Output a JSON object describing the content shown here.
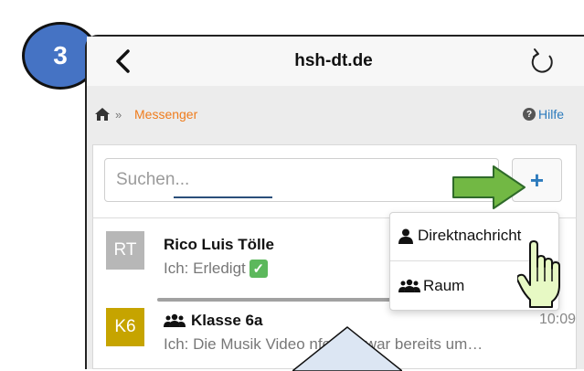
{
  "step_badge": "3",
  "browser": {
    "url": "hsh-dt.de",
    "back_icon": "chevron-left-icon",
    "reload_icon": "reload-icon"
  },
  "breadcrumb": {
    "home_icon": "home-icon",
    "separator": "»",
    "current": "Messenger",
    "help_label": "Hilfe"
  },
  "search": {
    "placeholder": "Suchen...",
    "add_label": "+"
  },
  "menu": {
    "items": [
      {
        "label": "Direktnachricht",
        "icon": "user-icon"
      },
      {
        "label": "Raum",
        "icon": "users-icon"
      }
    ]
  },
  "conversations": [
    {
      "initials": "RT",
      "name": "Rico Luis Tölle",
      "preview": "Ich: Erledigt",
      "badge_icon": "check-icon",
      "avatar_color": "#b7b7b7"
    },
    {
      "initials": "K6",
      "name": "Klasse 6a",
      "preview": "Ich: Die Musik Video  nferenz war bereits um…",
      "time": "10:09",
      "group_icon": "users-icon",
      "avatar_color": "#c6a400"
    }
  ],
  "colors": {
    "accent_blue": "#2d7bbd",
    "breadcrumb_orange": "#ef7c1d",
    "badge_blue": "#4573c4",
    "arrow_green": "#72b844"
  }
}
